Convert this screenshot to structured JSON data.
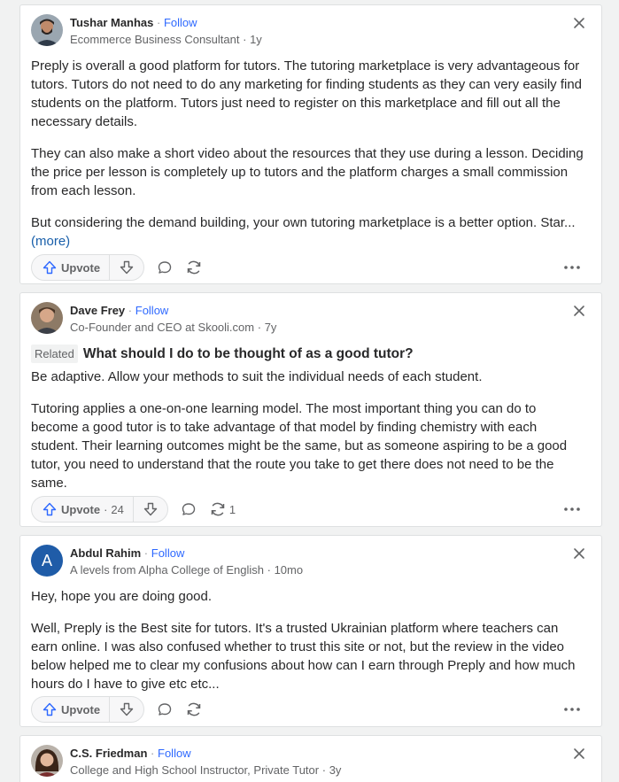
{
  "answers": [
    {
      "author": "Tushar Manhas",
      "follow": "Follow",
      "credential": "Ecommerce Business Consultant",
      "age": "1y",
      "paragraphs": [
        "Preply is overall a good platform for tutors. The tutoring marketplace is very advantageous for tutors. Tutors do not need to do any marketing for finding students as they can very easily find students on the platform. Tutors just need to register on this marketplace and fill out all the necessary details.",
        "They can also make a short video about the resources that they use during a lesson. Deciding the price per lesson is completely up to tutors and the platform charges a small commission from each lesson.",
        "But considering the demand building, your own tutoring marketplace is a better option. Star..."
      ],
      "more": "(more)",
      "upvote": "Upvote"
    },
    {
      "author": "Dave Frey",
      "follow": "Follow",
      "credential": "Co-Founder and CEO at Skooli.com",
      "age": "7y",
      "related_tag": "Related",
      "related_question": "What should I do to be thought of as a good tutor?",
      "paragraphs": [
        "Be adaptive. Allow your methods to suit the individual needs of each student.",
        "Tutoring applies a one-on-one learning model. The most important thing you can do to become a good tutor is to take advantage of that model by finding chemistry with each student. Their learning outcomes might be the same, but as someone aspiring to be a good tutor, you need to understand that the route you take to get there does not need to be the same."
      ],
      "upvote": "Upvote",
      "upvote_count": "24",
      "share_count": "1"
    },
    {
      "author": "Abdul Rahim",
      "avatar_letter": "A",
      "follow": "Follow",
      "credential": "A levels from Alpha College of English",
      "age": "10mo",
      "paragraphs": [
        "Hey, hope you are doing good.",
        "Well, Preply is the Best site for tutors. It's a trusted Ukrainian platform where teachers can earn online. I was also confused whether to trust this site or not, but the review in the video below helped me to clear my confusions about how can I earn through Preply and how much hours do I have to give etc etc..."
      ],
      "upvote": "Upvote"
    },
    {
      "author": "C.S. Friedman",
      "follow": "Follow",
      "credential": "College and High School Instructor, Private Tutor",
      "age": "3y"
    }
  ],
  "separator": "·",
  "colors": {
    "link": "#2e69ff",
    "more": "#195faa",
    "avatar_a": "#1f5ca8"
  },
  "icons": [
    "close-icon",
    "upvote-arrow-icon",
    "downvote-arrow-icon",
    "comment-icon",
    "share-icon",
    "more-options-icon"
  ]
}
